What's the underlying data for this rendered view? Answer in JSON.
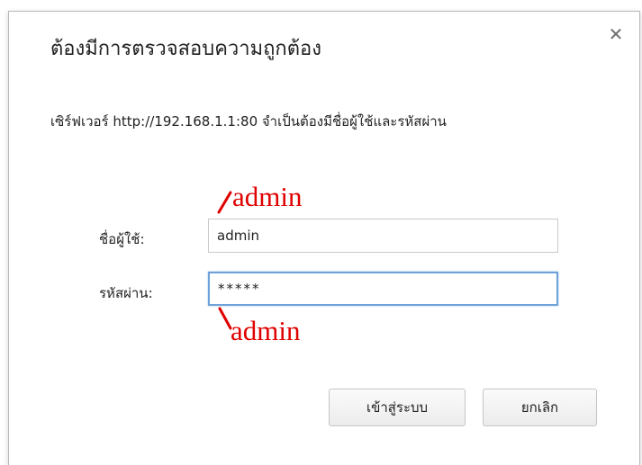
{
  "dialog": {
    "title": "ต้องมีการตรวจสอบความถูกต้อง",
    "message": "เซิร์ฟเวอร์ http://192.168.1.1:80 จำเป็นต้องมีชื่อผู้ใช้และรหัสผ่าน",
    "close_icon": "close-icon",
    "username": {
      "label": "ชื่อผู้ใช้:",
      "value": "admin"
    },
    "password": {
      "label": "รหัสผ่าน:",
      "value": "*****"
    },
    "buttons": {
      "login": "เข้าสู่ระบบ",
      "cancel": "ยกเลิก"
    }
  },
  "annotations": {
    "username_hint": "admin",
    "password_hint": "admin",
    "color": "#e00000"
  },
  "colors": {
    "focus_border": "#6ea2d9"
  }
}
